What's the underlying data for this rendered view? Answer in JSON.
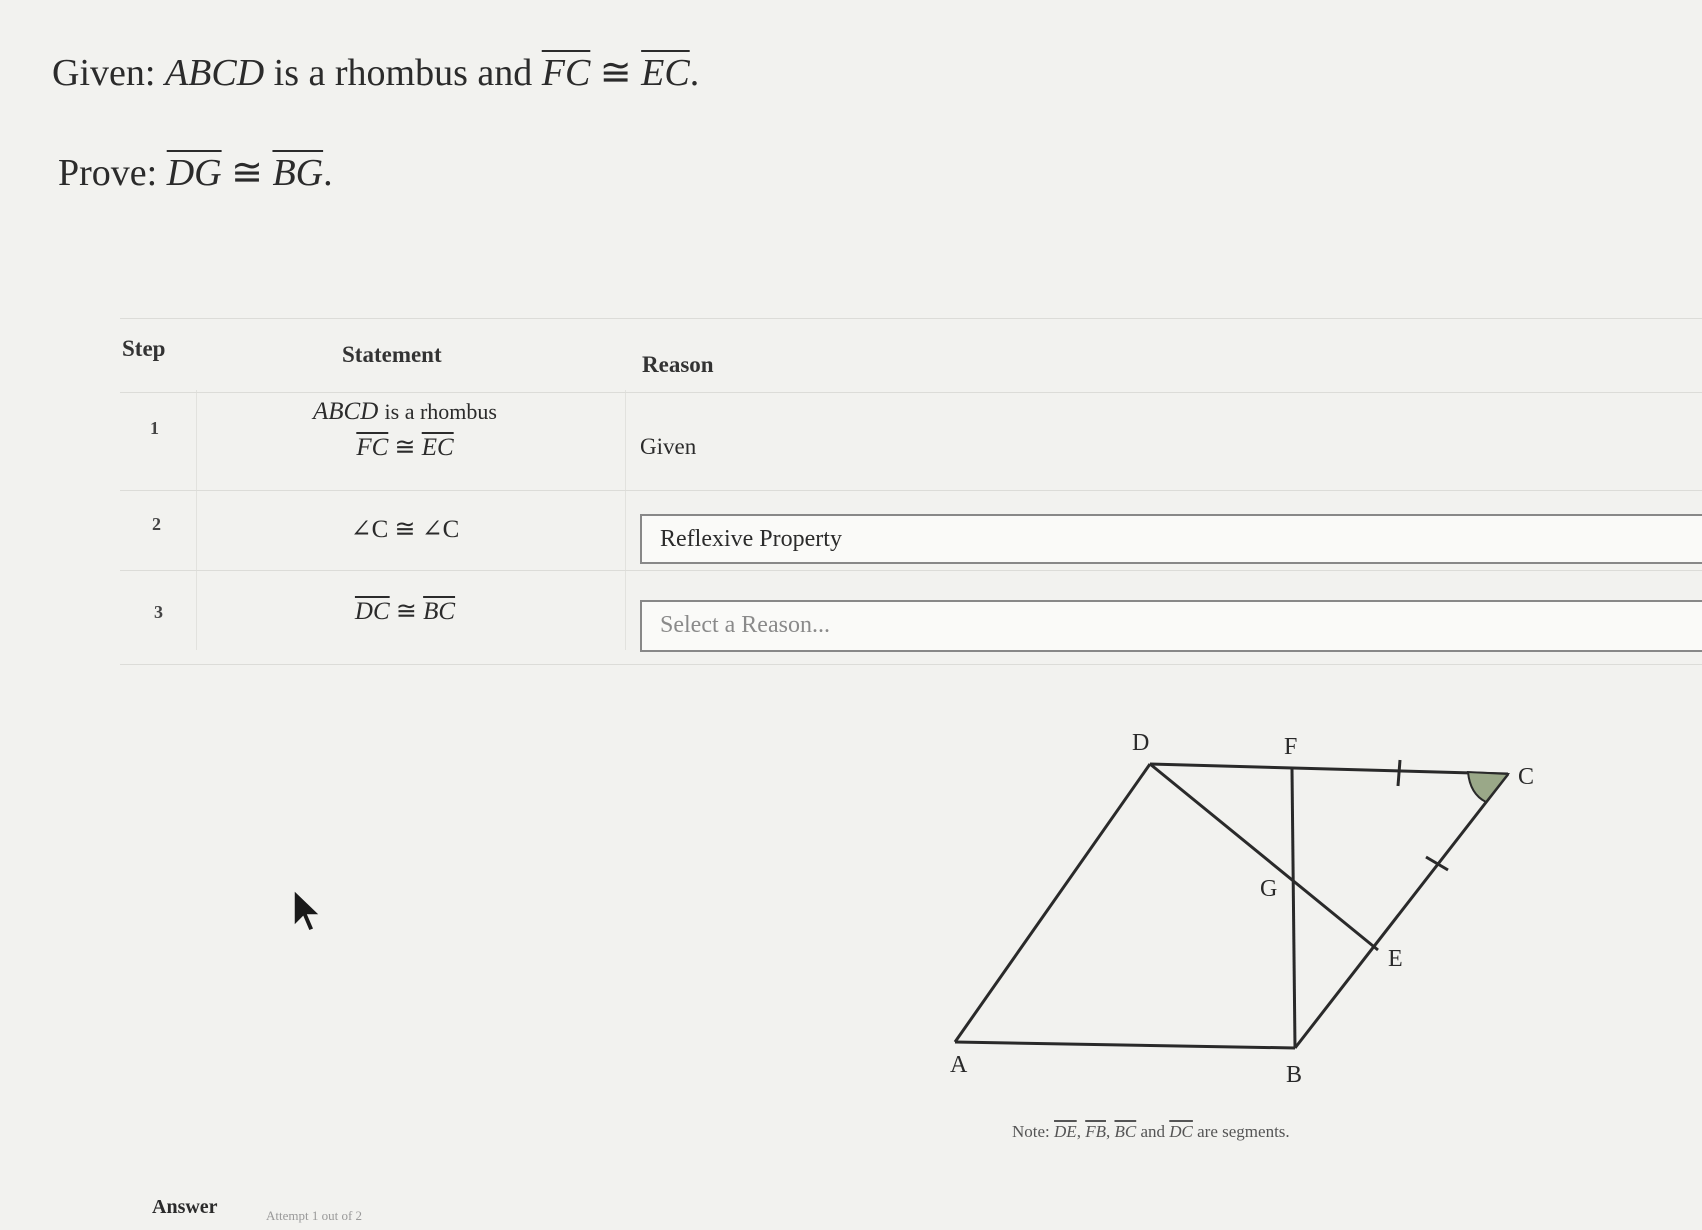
{
  "given": {
    "label": "Given:",
    "figure": "ABCD",
    "text1": "is a rhombus and",
    "seg1": "FC",
    "cong": "≅",
    "seg2": "EC",
    "end": "."
  },
  "prove": {
    "label": "Prove:",
    "seg1": "DG",
    "cong": "≅",
    "seg2": "BG",
    "end": "."
  },
  "table": {
    "headers": {
      "step": "Step",
      "statement": "Statement",
      "reason": "Reason"
    },
    "rows": [
      {
        "step": "1",
        "statement_line1_fig": "ABCD",
        "statement_line1_text": "is a rhombus",
        "statement_line2_seg1": "FC",
        "statement_line2_seg2": "EC",
        "cong": "≅",
        "reason": "Given"
      },
      {
        "step": "2",
        "statement": "∠C ≅ ∠C",
        "reason": "Reflexive Property"
      },
      {
        "step": "3",
        "statement_seg1": "DC",
        "statement_seg2": "BC",
        "cong": "≅",
        "reason_placeholder": "Select a Reason..."
      }
    ]
  },
  "diagram": {
    "labels": {
      "D": "D",
      "F": "F",
      "C": "C",
      "G": "G",
      "E": "E",
      "A": "A",
      "B": "B"
    },
    "colors": {
      "angle_fill": "#9aa888",
      "line": "#2a2a2a"
    }
  },
  "note": {
    "prefix": "Note:",
    "seg1": "DE",
    "seg2": "FB",
    "seg3": "BC",
    "and": "and",
    "seg4": "DC",
    "suffix": "are segments."
  },
  "answer": {
    "label": "Answer",
    "sub": "Attempt 1 out of 2"
  }
}
